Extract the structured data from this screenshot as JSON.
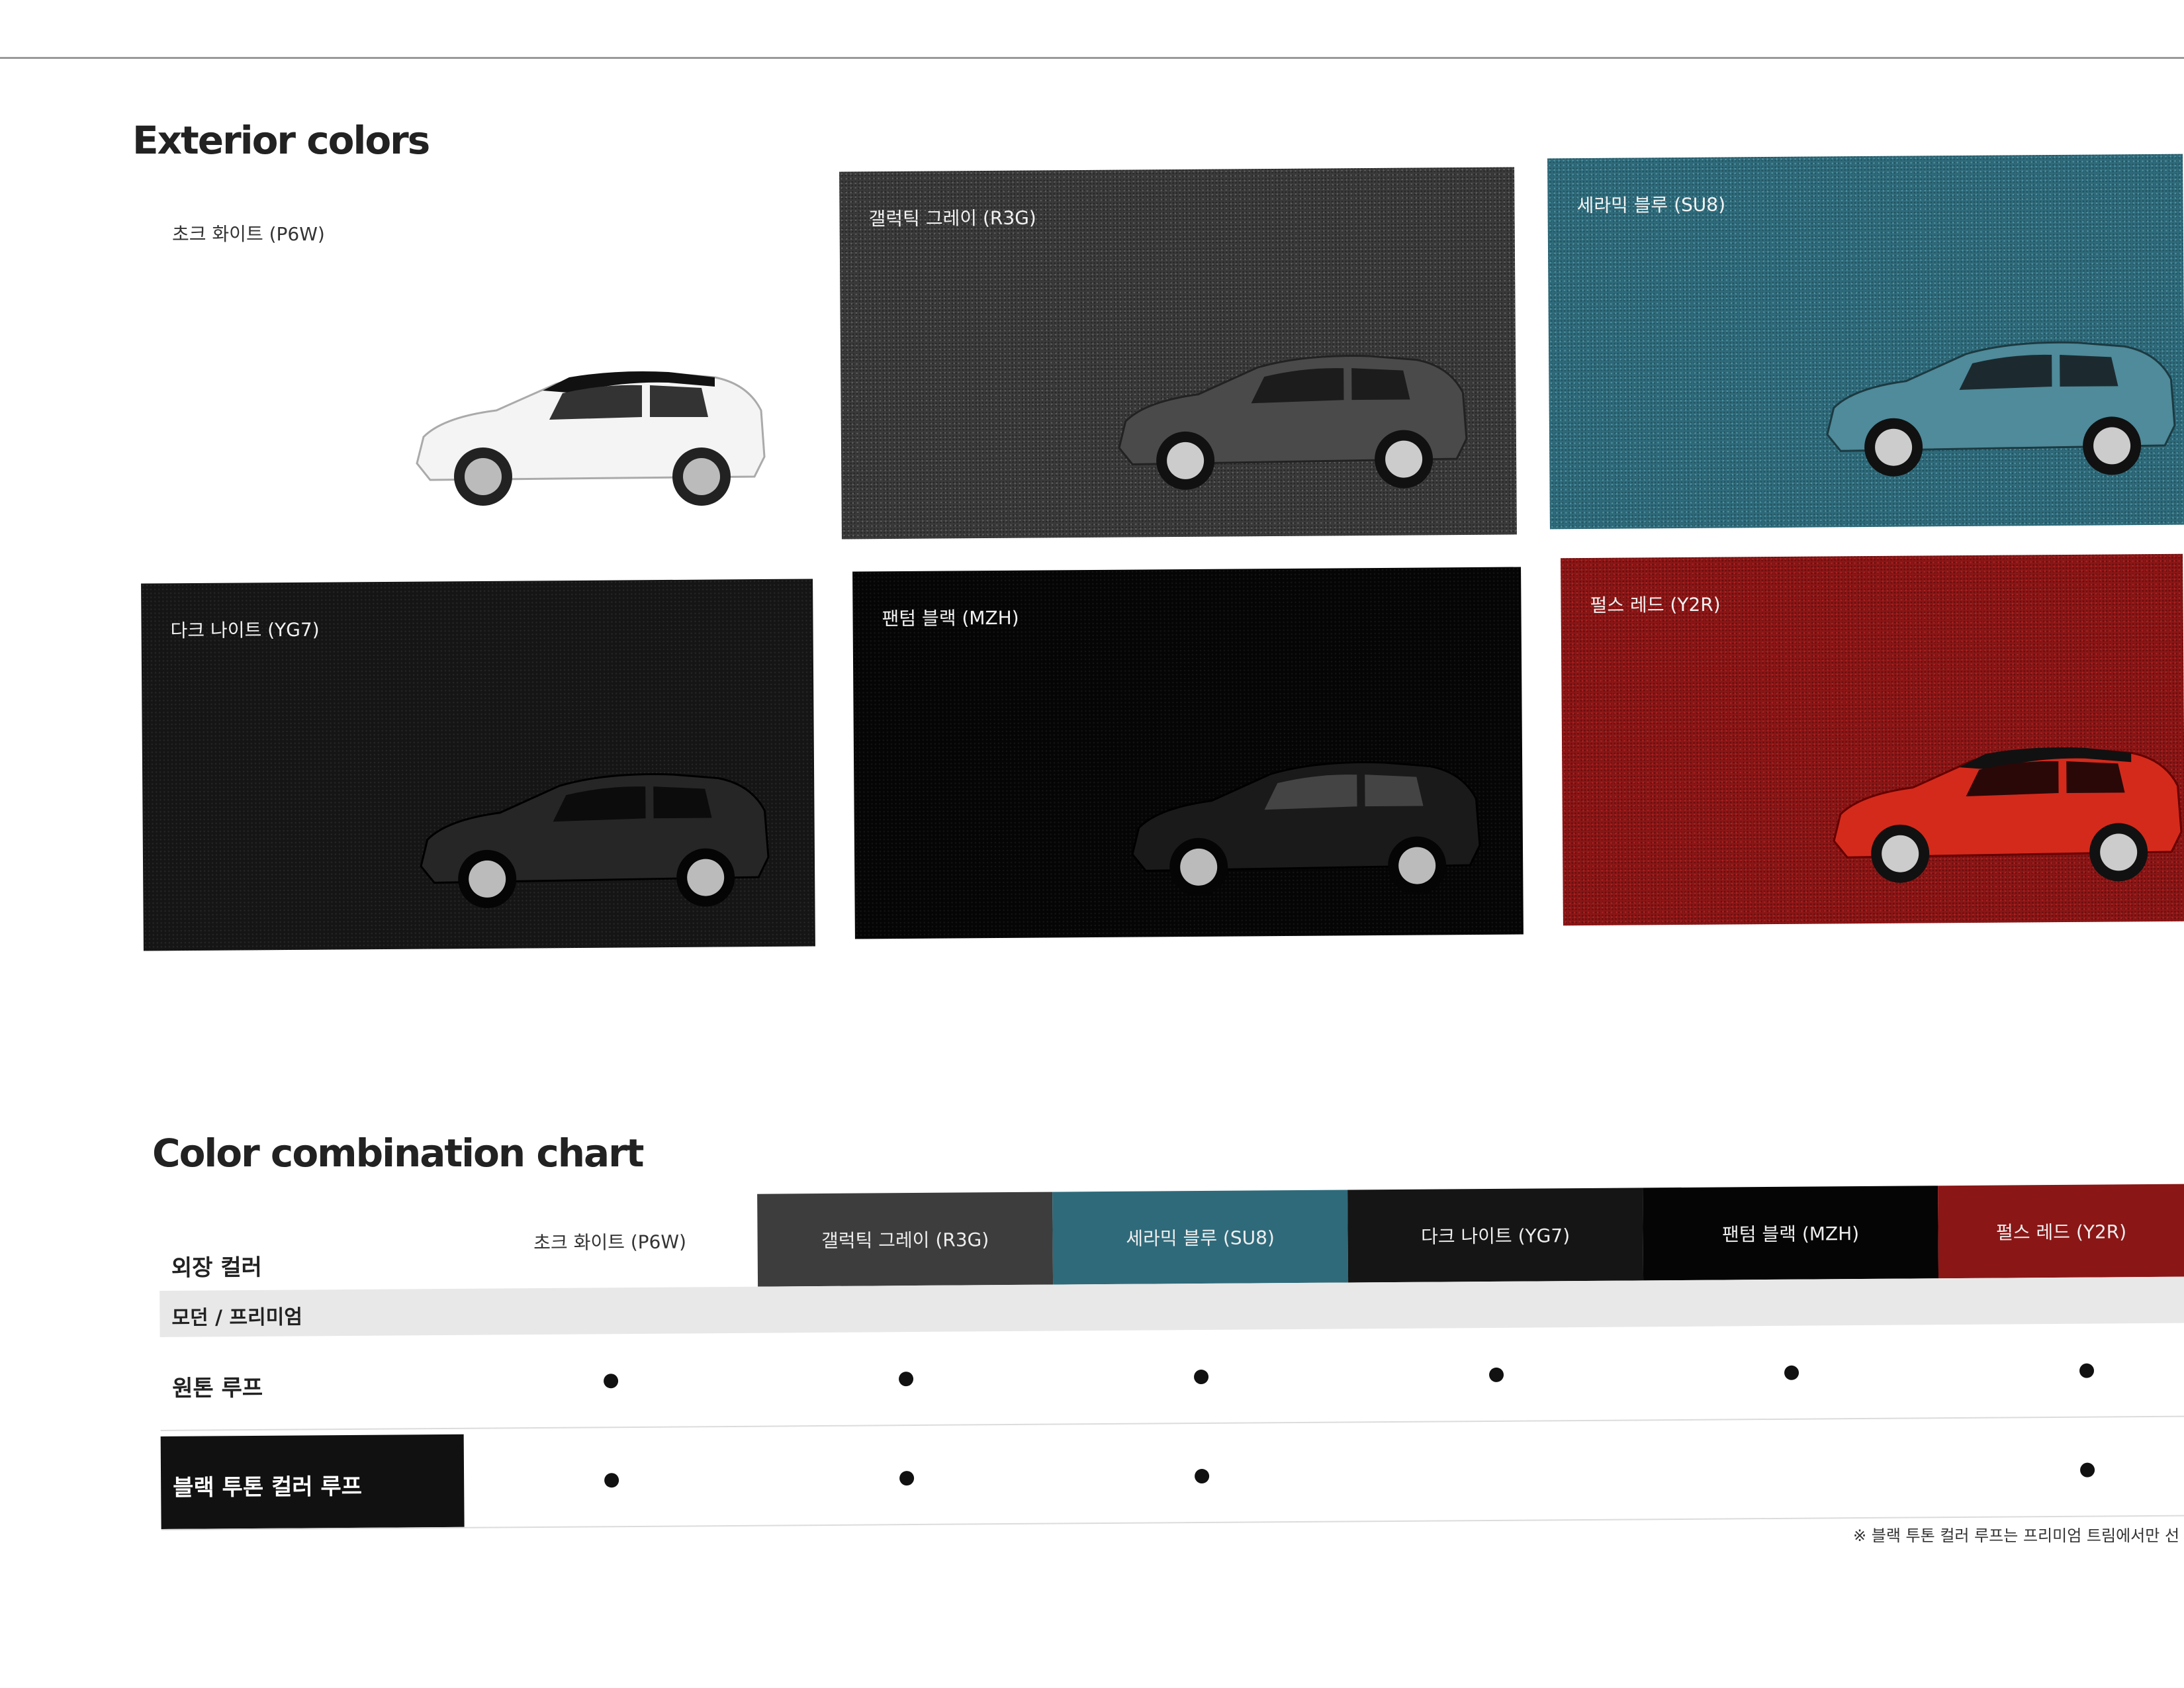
{
  "exterior": {
    "title": "Exterior colors",
    "swatches": [
      {
        "name": "초크 화이트 (P6W)"
      },
      {
        "name": "갤럭틱 그레이 (R3G)"
      },
      {
        "name": "세라믹 블루 (SU8)"
      },
      {
        "name": "다크 나이트 (YG7)"
      },
      {
        "name": "팬텀 블랙 (MZH)"
      },
      {
        "name": "펄스 레드 (Y2R)"
      }
    ]
  },
  "colors": {
    "white": "#ffffff",
    "gray": "#3a3a3a",
    "blue": "#2f6a7a",
    "dark_night": "#151515",
    "phantom_black": "#050505",
    "red": "#8a1616"
  },
  "combo": {
    "title": "Color combination chart",
    "header_label": "외장 컬러",
    "columns": [
      "초크 화이트 (P6W)",
      "갤럭틱 그레이 (R3G)",
      "세라믹 블루 (SU8)",
      "다크 나이트 (YG7)",
      "팬텀 블랙 (MZH)",
      "펄스 레드 (Y2R)"
    ],
    "trim_label": "모던 / 프리미엄",
    "rows": [
      {
        "label": "원톤 루프",
        "available": [
          true,
          true,
          true,
          true,
          true,
          true
        ]
      },
      {
        "label": "블랙 투톤 컬러 루프",
        "available": [
          true,
          true,
          true,
          false,
          false,
          true
        ]
      }
    ],
    "footnote": "※ 블랙 투톤 컬러 루프는 프리미엄 트림에서만 선"
  }
}
